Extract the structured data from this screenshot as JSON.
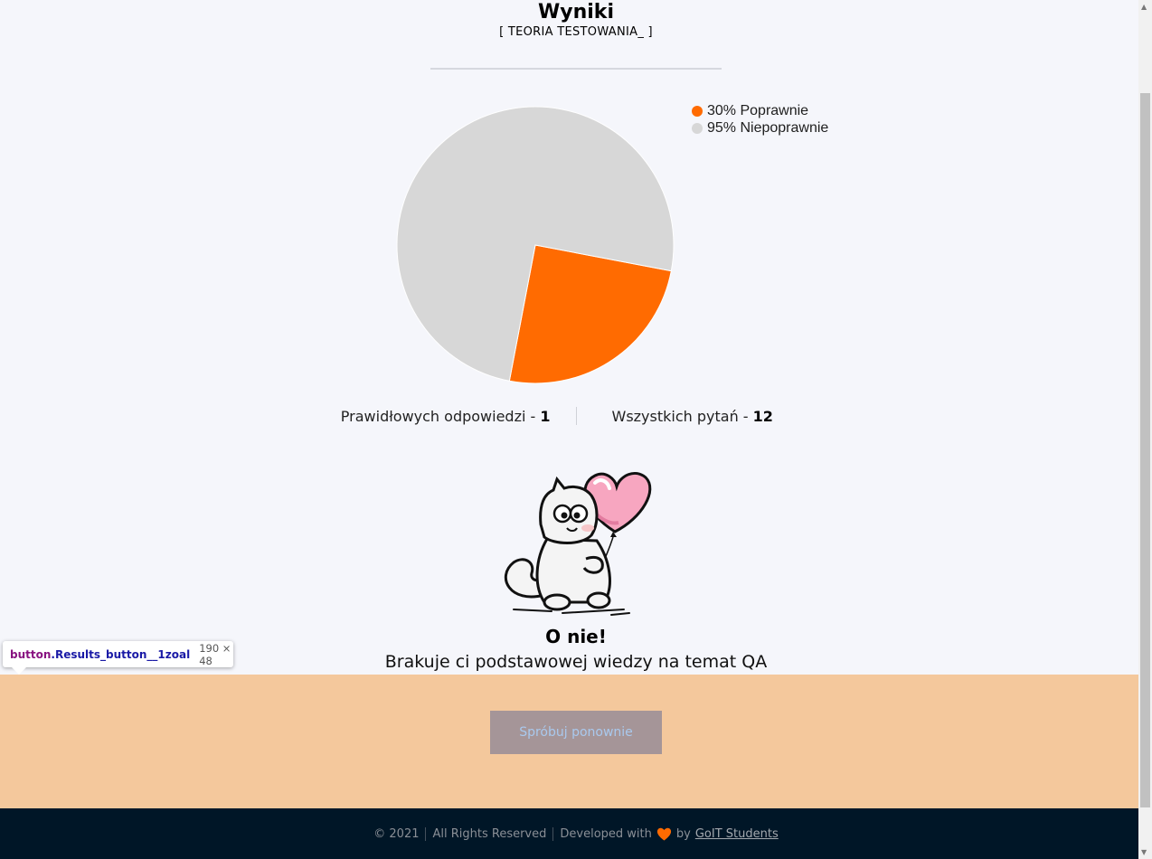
{
  "header": {
    "title": "Wyniki",
    "subtitle": "[ TEORIA TESTOWANIA_ ]"
  },
  "chart_data": {
    "type": "pie",
    "legend_position": "top-right",
    "series": [
      {
        "label": "30% Poprawnie",
        "value": 25,
        "color": "#ff6b01"
      },
      {
        "label": "95% Niepoprawnie",
        "value": 75,
        "color": "#d7d7d7"
      }
    ]
  },
  "stats": {
    "correct_label": "Prawidłowych odpowiedzi - ",
    "correct_value": "1",
    "total_label": "Wszystkich pytań - ",
    "total_value": "12"
  },
  "result": {
    "title": "O nie!",
    "message": "Brakuje ci podstawowej wiedzy na temat QA"
  },
  "actions": {
    "retry_label": "Spróbuj ponownie"
  },
  "devtools_tooltip": {
    "tag": "button",
    "class_name": ".Results_button__1zoal",
    "dims": "190 × 48"
  },
  "footer": {
    "copyright": "© 2021",
    "rights": "All Rights Reserved",
    "developed": "Developed with",
    "by": "by",
    "link": "GoIT Students"
  },
  "colors": {
    "accent": "#ff6b01",
    "background": "#f5f6fb",
    "button_zone": "#f4c89c",
    "footer": "#001627"
  }
}
